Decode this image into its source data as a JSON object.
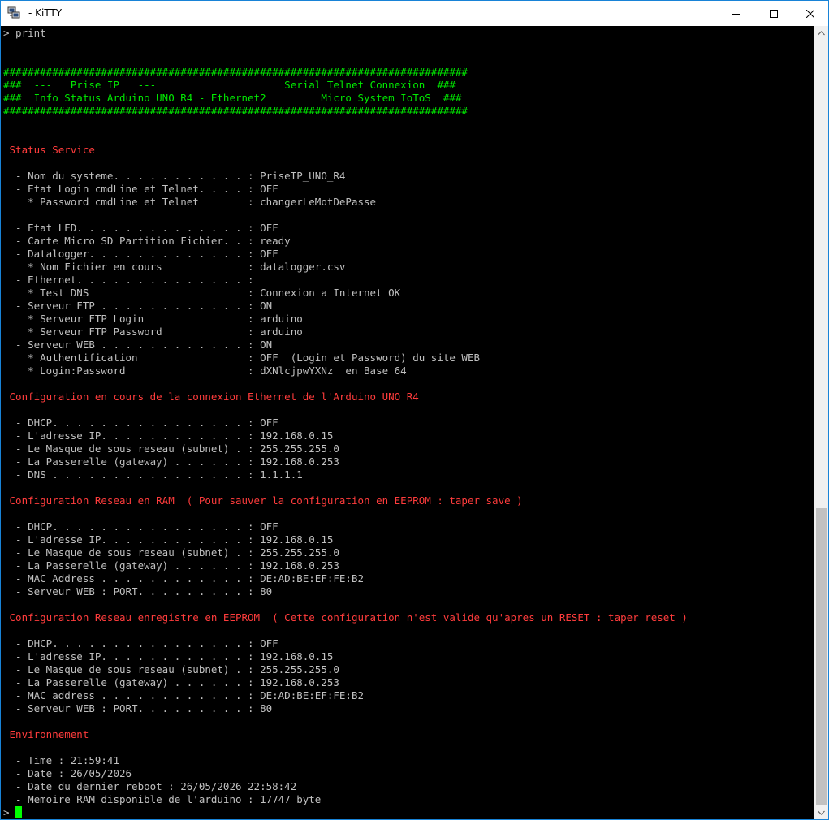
{
  "window": {
    "title": "- KiTTY",
    "icon": "putty-computers-icon",
    "buttons": {
      "minimize": "minimize-icon",
      "maximize": "maximize-icon",
      "close": "close-icon"
    }
  },
  "colors": {
    "text": "#c0c0c0",
    "red": "#ff3c3c",
    "green": "#00e800",
    "cursor": "#00ff00",
    "background": "#000000"
  },
  "terminal": {
    "lines": [
      {
        "text": "> print",
        "color": "text"
      },
      {
        "text": "",
        "color": "text"
      },
      {
        "text": "",
        "color": "text"
      },
      {
        "text": "############################################################################",
        "color": "green"
      },
      {
        "text": "###  ---   Prise IP   ---                     Serial Telnet Connexion  ###",
        "color": "green"
      },
      {
        "text": "###  Info Status Arduino UNO R4 - Ethernet2         Micro System IoToS  ###",
        "color": "green"
      },
      {
        "text": "############################################################################",
        "color": "green"
      },
      {
        "text": "",
        "color": "text"
      },
      {
        "text": "",
        "color": "text"
      },
      {
        "text": " Status Service",
        "color": "red"
      },
      {
        "text": "",
        "color": "text"
      },
      {
        "text": "  - Nom du systeme. . . . . . . . . . . : PriseIP_UNO_R4",
        "color": "text"
      },
      {
        "text": "  - Etat Login cmdLine et Telnet. . . . : OFF",
        "color": "text"
      },
      {
        "text": "    * Password cmdLine et Telnet        : changerLeMotDePasse",
        "color": "text"
      },
      {
        "text": "",
        "color": "text"
      },
      {
        "text": "  - Etat LED. . . . . . . . . . . . . . : OFF",
        "color": "text"
      },
      {
        "text": "  - Carte Micro SD Partition Fichier. . : ready",
        "color": "text"
      },
      {
        "text": "  - Datalogger. . . . . . . . . . . . . : OFF",
        "color": "text"
      },
      {
        "text": "    * Nom Fichier en cours              : datalogger.csv",
        "color": "text"
      },
      {
        "text": "  - Ethernet. . . . . . . . . . . . . . :",
        "color": "text"
      },
      {
        "text": "    * Test DNS                          : Connexion a Internet OK",
        "color": "text"
      },
      {
        "text": "  - Serveur FTP . . . . . . . . . . . . : ON",
        "color": "text"
      },
      {
        "text": "    * Serveur FTP Login                 : arduino",
        "color": "text"
      },
      {
        "text": "    * Serveur FTP Password              : arduino",
        "color": "text"
      },
      {
        "text": "  - Serveur WEB . . . . . . . . . . . . : ON",
        "color": "text"
      },
      {
        "text": "    * Authentification                  : OFF  (Login et Password) du site WEB",
        "color": "text"
      },
      {
        "text": "    * Login:Password                    : dXNlcjpwYXNz  en Base 64",
        "color": "text"
      },
      {
        "text": "",
        "color": "text"
      },
      {
        "text": " Configuration en cours de la connexion Ethernet de l'Arduino UNO R4",
        "color": "red"
      },
      {
        "text": "",
        "color": "text"
      },
      {
        "text": "  - DHCP. . . . . . . . . . . . . . . . : OFF",
        "color": "text"
      },
      {
        "text": "  - L'adresse IP. . . . . . . . . . . . : 192.168.0.15",
        "color": "text"
      },
      {
        "text": "  - Le Masque de sous reseau (subnet) . : 255.255.255.0",
        "color": "text"
      },
      {
        "text": "  - La Passerelle (gateway) . . . . . . : 192.168.0.253",
        "color": "text"
      },
      {
        "text": "  - DNS . . . . . . . . . . . . . . . . : 1.1.1.1",
        "color": "text"
      },
      {
        "text": "",
        "color": "text"
      },
      {
        "text": " Configuration Reseau en RAM  ( Pour sauver la configuration en EEPROM : taper save )",
        "color": "red"
      },
      {
        "text": "",
        "color": "text"
      },
      {
        "text": "  - DHCP. . . . . . . . . . . . . . . . : OFF",
        "color": "text"
      },
      {
        "text": "  - L'adresse IP. . . . . . . . . . . . : 192.168.0.15",
        "color": "text"
      },
      {
        "text": "  - Le Masque de sous reseau (subnet) . : 255.255.255.0",
        "color": "text"
      },
      {
        "text": "  - La Passerelle (gateway) . . . . . . : 192.168.0.253",
        "color": "text"
      },
      {
        "text": "  - MAC Address . . . . . . . . . . . . : DE:AD:BE:EF:FE:B2",
        "color": "text"
      },
      {
        "text": "  - Serveur WEB : PORT. . . . . . . . . : 80",
        "color": "text"
      },
      {
        "text": "",
        "color": "text"
      },
      {
        "text": " Configuration Reseau enregistre en EEPROM  ( Cette configuration n'est valide qu'apres un RESET : taper reset )",
        "color": "red"
      },
      {
        "text": "",
        "color": "text"
      },
      {
        "text": "  - DHCP. . . . . . . . . . . . . . . . : OFF",
        "color": "text"
      },
      {
        "text": "  - L'adresse IP. . . . . . . . . . . . : 192.168.0.15",
        "color": "text"
      },
      {
        "text": "  - Le Masque de sous reseau (subnet) . : 255.255.255.0",
        "color": "text"
      },
      {
        "text": "  - La Passerelle (gateway) . . . . . . : 192.168.0.253",
        "color": "text"
      },
      {
        "text": "  - MAC address . . . . . . . . . . . . : DE:AD:BE:EF:FE:B2",
        "color": "text"
      },
      {
        "text": "  - Serveur WEB : PORT. . . . . . . . . : 80",
        "color": "text"
      },
      {
        "text": "",
        "color": "text"
      },
      {
        "text": " Environnement",
        "color": "red"
      },
      {
        "text": "",
        "color": "text"
      },
      {
        "text": "  - Time : 21:59:41",
        "color": "text"
      },
      {
        "text": "  - Date : 26/05/2026",
        "color": "text"
      },
      {
        "text": "  - Date du dernier reboot : 26/05/2026 22:58:42",
        "color": "text"
      },
      {
        "text": "  - Memoire RAM disponible de l'arduino : 17747 byte",
        "color": "text"
      },
      {
        "text": "> ",
        "color": "text"
      }
    ]
  }
}
